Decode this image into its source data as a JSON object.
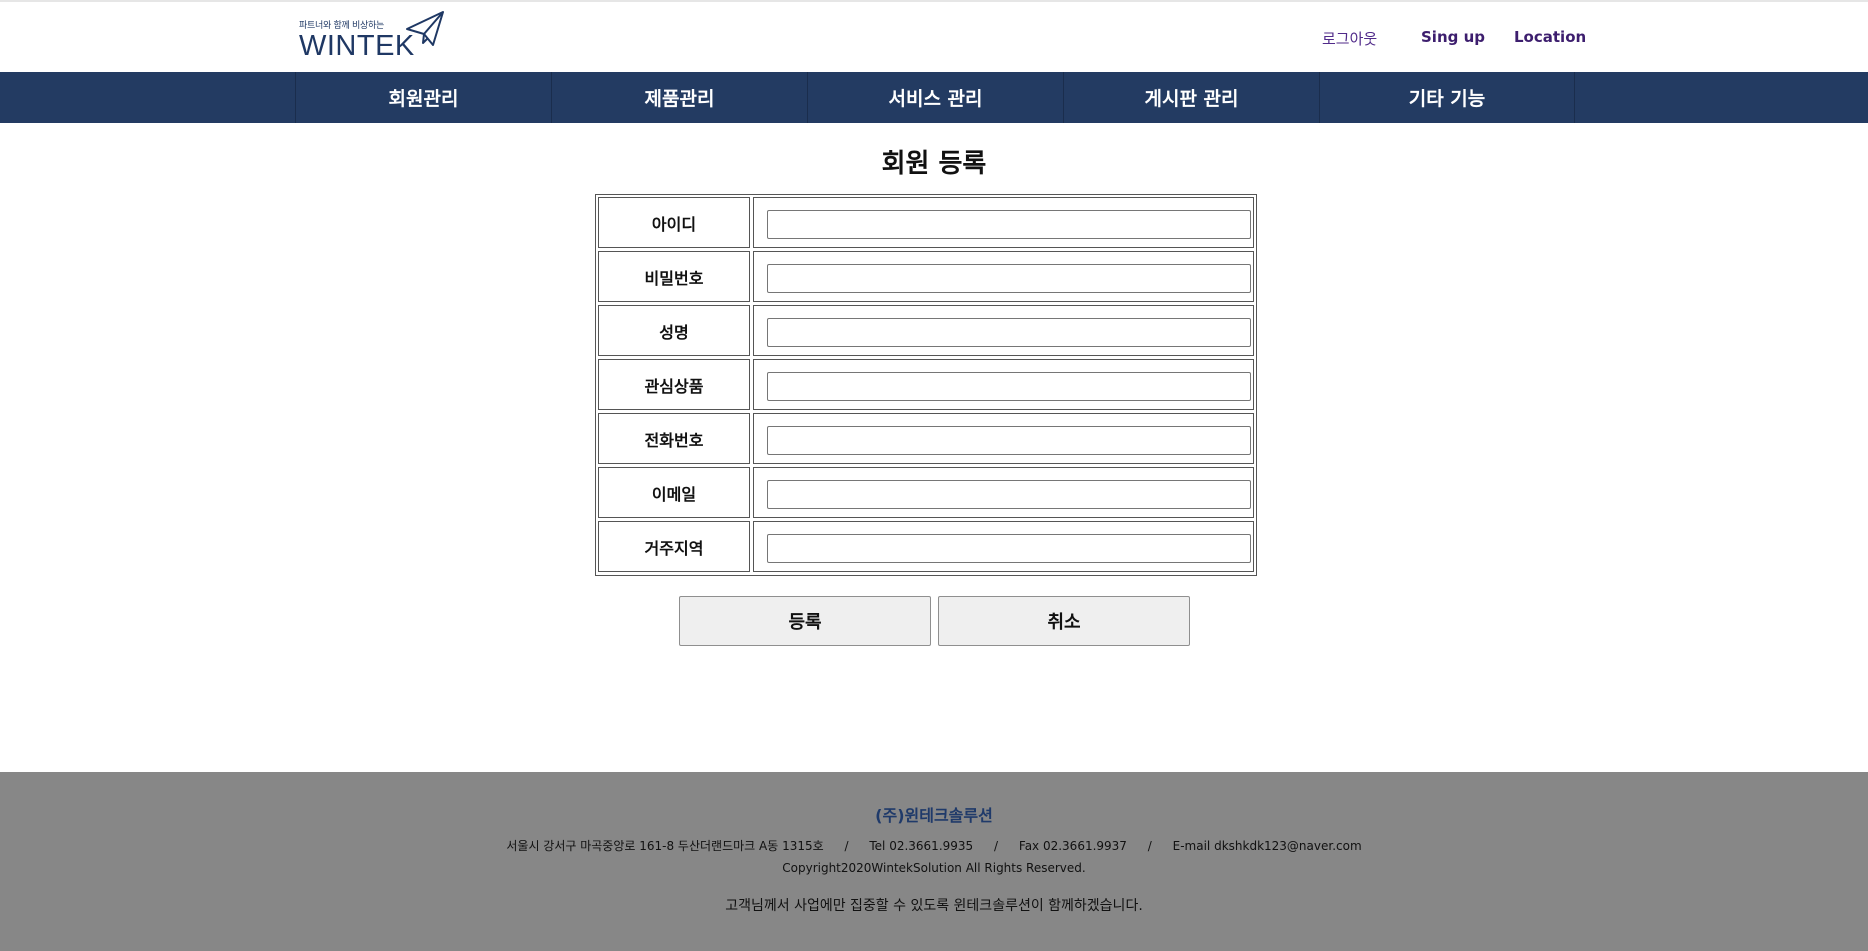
{
  "header": {
    "logo_tagline": "파트너와 함께 비상하는",
    "logo_text": "WINTEK",
    "links": {
      "logout": "로그아웃",
      "signup": "Sing up",
      "location": "Location"
    }
  },
  "nav": {
    "items": [
      "회원관리",
      "제품관리",
      "서비스 관리",
      "게시판 관리",
      "기타 기능"
    ]
  },
  "main": {
    "title": "회원 등록",
    "fields": [
      {
        "label": "아이디",
        "value": ""
      },
      {
        "label": "비밀번호",
        "value": ""
      },
      {
        "label": "성명",
        "value": ""
      },
      {
        "label": "관심상품",
        "value": ""
      },
      {
        "label": "전화번호",
        "value": ""
      },
      {
        "label": "이메일",
        "value": ""
      },
      {
        "label": "거주지역",
        "value": ""
      }
    ],
    "submit_label": "등록",
    "cancel_label": "취소"
  },
  "footer": {
    "company": "(주)윈테크솔루션",
    "address": "서울시 강서구 마곡중앙로 161-8 두산더랜드마크 A동 1315호",
    "tel": "Tel 02.3661.9935",
    "fax": "Fax 02.3661.9937",
    "email": "E-mail dkshkdk123@naver.com",
    "separator": "/",
    "copyright": "Copyright2020WintekSolution All Rights Reserved.",
    "slogan": "고객님께서 사업에만 집중할 수 있도록 윈테크솔루션이 함께하겠습니다."
  },
  "colors": {
    "nav_bg": "#233b62",
    "footer_bg": "#878787",
    "brand": "#1f3864",
    "link": "#3d1e6e"
  }
}
